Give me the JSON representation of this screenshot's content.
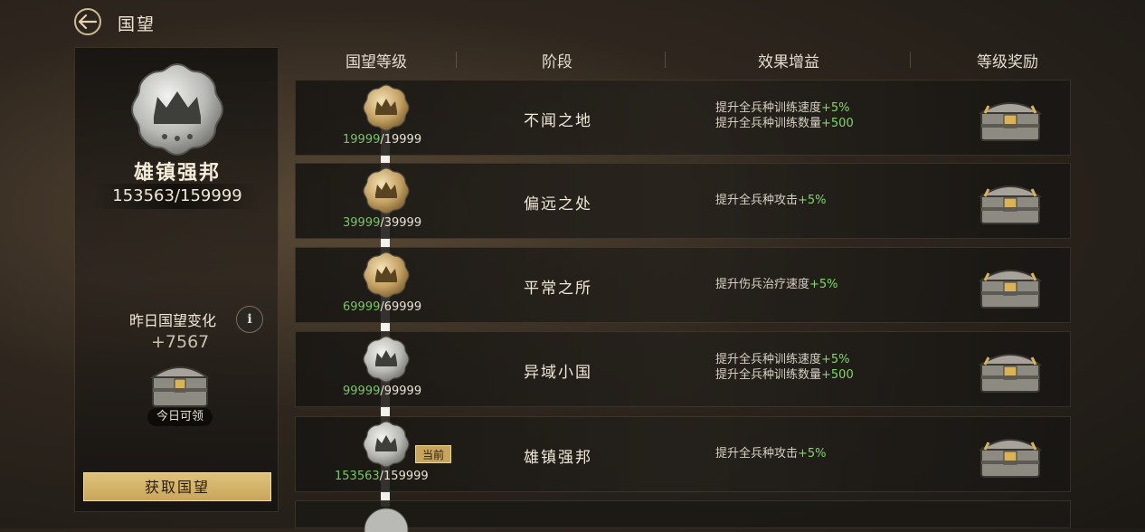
{
  "header": {
    "title": "国望",
    "back_icon": "back-arrow-icon"
  },
  "left_panel": {
    "rank_name": "雄镇强邦",
    "score": "153563/159999",
    "yesterday_label": "昨日国望变化",
    "info_label": "i",
    "yesterday_value": "+7567",
    "today_label": "今日可领",
    "get_button": "获取国望"
  },
  "table": {
    "headers": [
      "国望等级",
      "阶段",
      "效果增益",
      "等级奖励"
    ],
    "rows": [
      {
        "stage": "不闻之地",
        "progress_current": "19999",
        "progress_total": "/19999",
        "badge": "gold",
        "effects": [
          {
            "text": "提升全兵种训练速度",
            "bonus": "+5%"
          },
          {
            "text": "提升全兵种训练数量",
            "bonus": "+500"
          }
        ]
      },
      {
        "stage": "偏远之处",
        "progress_current": "39999",
        "progress_total": "/39999",
        "badge": "gold",
        "effects": [
          {
            "text": "提升全兵种攻击",
            "bonus": "+5%"
          }
        ]
      },
      {
        "stage": "平常之所",
        "progress_current": "69999",
        "progress_total": "/69999",
        "badge": "gold",
        "effects": [
          {
            "text": "提升伤兵治疗速度",
            "bonus": "+5%"
          }
        ]
      },
      {
        "stage": "异域小国",
        "progress_current": "99999",
        "progress_total": "/99999",
        "badge": "silver",
        "effects": [
          {
            "text": "提升全兵种训练速度",
            "bonus": "+5%"
          },
          {
            "text": "提升全兵种训练数量",
            "bonus": "+500"
          }
        ]
      },
      {
        "stage": "雄镇强邦",
        "progress_current": "153563",
        "progress_total": "/159999",
        "badge": "silver",
        "current_tag": "当前",
        "effects": [
          {
            "text": "提升全兵种攻击",
            "bonus": "+5%"
          }
        ]
      }
    ]
  },
  "colors": {
    "accent_gold": "#caa65a",
    "bonus_green": "#7fd96a",
    "text_light": "#f0e8d8"
  }
}
